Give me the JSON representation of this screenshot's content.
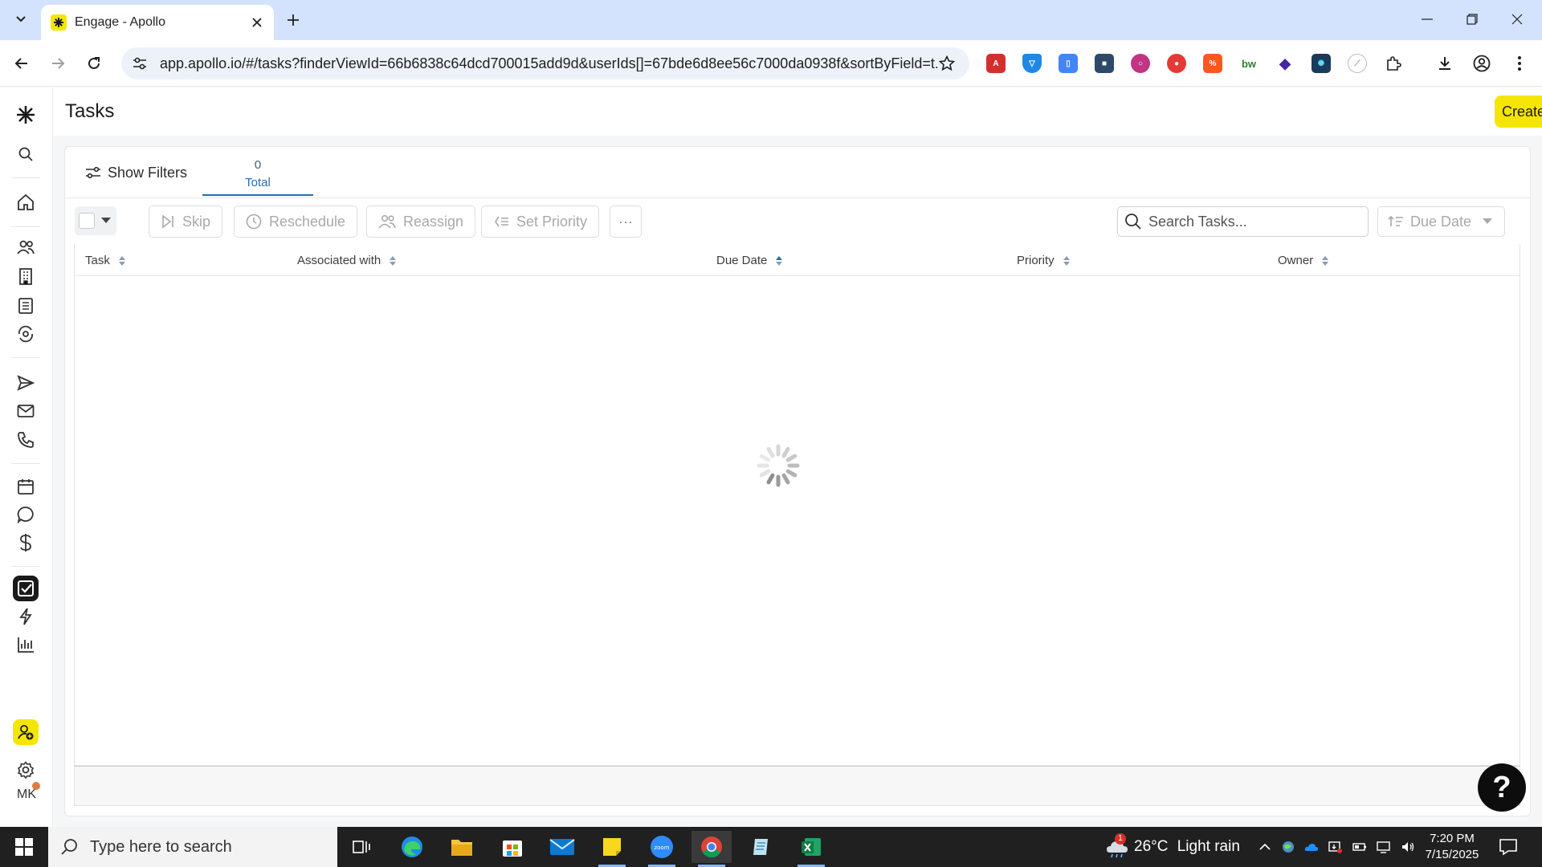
{
  "browser": {
    "tab_title": "Engage - Apollo",
    "url": "app.apollo.io/#/tasks?finderViewId=66b6838c64dcd700015add9d&userIds[]=67bde6d8ee56c7000da0938f&sortByField=t..."
  },
  "page": {
    "title": "Tasks",
    "create_label": "Create task"
  },
  "filters": {
    "show_filters_label": "Show Filters",
    "total_count": "0",
    "total_label": "Total"
  },
  "actions": {
    "skip": "Skip",
    "reschedule": "Reschedule",
    "reassign": "Reassign",
    "set_priority": "Set Priority",
    "more": "···",
    "search_placeholder": "Search Tasks...",
    "sort_label": "Due Date"
  },
  "table": {
    "columns": [
      "Task",
      "Associated with",
      "Due Date",
      "Priority",
      "Owner"
    ],
    "rows": []
  },
  "sidebar": {
    "user_initials": "MK"
  },
  "help": {
    "label": "?"
  },
  "taskbar": {
    "search_placeholder": "Type here to search",
    "weather_temp": "26°C",
    "weather_desc": "Light rain",
    "weather_badge": "1",
    "time": "7:20 PM",
    "date": "7/15/2025"
  },
  "colors": {
    "brand_yellow": "#f5e600",
    "link_blue": "#2b6cb0",
    "tabstrip_bg": "#d3e3fd"
  }
}
